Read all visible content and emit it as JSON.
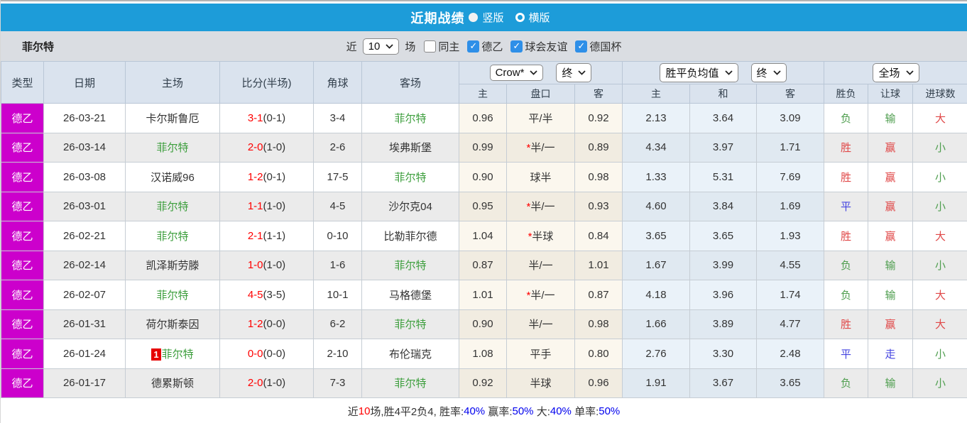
{
  "title_bar": {
    "title": "近期战绩",
    "radio_vertical": "竖版",
    "radio_horizontal": "横版"
  },
  "filter_bar": {
    "team": "菲尔特",
    "recent_label": "近",
    "recent_value": "10",
    "games_label": "场",
    "checkboxes": [
      {
        "label": "同主",
        "checked": false
      },
      {
        "label": "德乙",
        "checked": true
      },
      {
        "label": "球会友谊",
        "checked": true
      },
      {
        "label": "德国杯",
        "checked": true
      }
    ]
  },
  "table": {
    "columns": [
      "类型",
      "日期",
      "主场",
      "比分(半场)",
      "角球",
      "客场"
    ],
    "selects": {
      "bookmaker": "Crow*",
      "bookmaker_time": "终",
      "europe": "胜平负均值",
      "europe_time": "终",
      "scope": "全场"
    },
    "sub_columns": [
      "主",
      "盘口",
      "客",
      "主",
      "和",
      "客",
      "胜负",
      "让球",
      "进球数"
    ],
    "rows": [
      {
        "league": "德乙",
        "date": "26-03-21",
        "badge": "",
        "home": "卡尔斯鲁厄",
        "home_focus": false,
        "score": "3-1",
        "half": "(0-1)",
        "corners": "3-4",
        "away": "菲尔特",
        "away_focus": true,
        "ah_home": "0.96",
        "star": false,
        "handicap": "平/半",
        "ah_away": "0.92",
        "eu_home": "2.13",
        "eu_draw": "3.64",
        "eu_away": "3.09",
        "result": "负",
        "result_color": "green",
        "let_result": "输",
        "let_color": "green",
        "goal_result": "大",
        "goal_color": "red"
      },
      {
        "league": "德乙",
        "date": "26-03-14",
        "badge": "",
        "home": "菲尔特",
        "home_focus": true,
        "score": "2-0",
        "half": "(1-0)",
        "corners": "2-6",
        "away": "埃弗斯堡",
        "away_focus": false,
        "ah_home": "0.99",
        "star": true,
        "handicap": "半/一",
        "ah_away": "0.89",
        "eu_home": "4.34",
        "eu_draw": "3.97",
        "eu_away": "1.71",
        "result": "胜",
        "result_color": "red",
        "let_result": "赢",
        "let_color": "red",
        "goal_result": "小",
        "goal_color": "green"
      },
      {
        "league": "德乙",
        "date": "26-03-08",
        "badge": "",
        "home": "汉诺威96",
        "home_focus": false,
        "score": "1-2",
        "half": "(0-1)",
        "corners": "17-5",
        "away": "菲尔特",
        "away_focus": true,
        "ah_home": "0.90",
        "star": false,
        "handicap": "球半",
        "ah_away": "0.98",
        "eu_home": "1.33",
        "eu_draw": "5.31",
        "eu_away": "7.69",
        "result": "胜",
        "result_color": "red",
        "let_result": "赢",
        "let_color": "red",
        "goal_result": "小",
        "goal_color": "green"
      },
      {
        "league": "德乙",
        "date": "26-03-01",
        "badge": "",
        "home": "菲尔特",
        "home_focus": true,
        "score": "1-1",
        "half": "(1-0)",
        "corners": "4-5",
        "away": "沙尔克04",
        "away_focus": false,
        "ah_home": "0.95",
        "star": true,
        "handicap": "半/一",
        "ah_away": "0.93",
        "eu_home": "4.60",
        "eu_draw": "3.84",
        "eu_away": "1.69",
        "result": "平",
        "result_color": "blue",
        "let_result": "赢",
        "let_color": "red",
        "goal_result": "小",
        "goal_color": "green"
      },
      {
        "league": "德乙",
        "date": "26-02-21",
        "badge": "",
        "home": "菲尔特",
        "home_focus": true,
        "score": "2-1",
        "half": "(1-1)",
        "corners": "0-10",
        "away": "比勒菲尔德",
        "away_focus": false,
        "ah_home": "1.04",
        "star": true,
        "handicap": "半球",
        "ah_away": "0.84",
        "eu_home": "3.65",
        "eu_draw": "3.65",
        "eu_away": "1.93",
        "result": "胜",
        "result_color": "red",
        "let_result": "赢",
        "let_color": "red",
        "goal_result": "大",
        "goal_color": "red"
      },
      {
        "league": "德乙",
        "date": "26-02-14",
        "badge": "",
        "home": "凯泽斯劳滕",
        "home_focus": false,
        "score": "1-0",
        "half": "(1-0)",
        "corners": "1-6",
        "away": "菲尔特",
        "away_focus": true,
        "ah_home": "0.87",
        "star": false,
        "handicap": "半/一",
        "ah_away": "1.01",
        "eu_home": "1.67",
        "eu_draw": "3.99",
        "eu_away": "4.55",
        "result": "负",
        "result_color": "green",
        "let_result": "输",
        "let_color": "green",
        "goal_result": "小",
        "goal_color": "green"
      },
      {
        "league": "德乙",
        "date": "26-02-07",
        "badge": "",
        "home": "菲尔特",
        "home_focus": true,
        "score": "4-5",
        "half": "(3-5)",
        "corners": "10-1",
        "away": "马格德堡",
        "away_focus": false,
        "ah_home": "1.01",
        "star": true,
        "handicap": "半/一",
        "ah_away": "0.87",
        "eu_home": "4.18",
        "eu_draw": "3.96",
        "eu_away": "1.74",
        "result": "负",
        "result_color": "green",
        "let_result": "输",
        "let_color": "green",
        "goal_result": "大",
        "goal_color": "red"
      },
      {
        "league": "德乙",
        "date": "26-01-31",
        "badge": "",
        "home": "荷尔斯泰因",
        "home_focus": false,
        "score": "1-2",
        "half": "(0-0)",
        "corners": "6-2",
        "away": "菲尔特",
        "away_focus": true,
        "ah_home": "0.90",
        "star": false,
        "handicap": "半/一",
        "ah_away": "0.98",
        "eu_home": "1.66",
        "eu_draw": "3.89",
        "eu_away": "4.77",
        "result": "胜",
        "result_color": "red",
        "let_result": "赢",
        "let_color": "red",
        "goal_result": "大",
        "goal_color": "red"
      },
      {
        "league": "德乙",
        "date": "26-01-24",
        "badge": "1",
        "home": "菲尔特",
        "home_focus": true,
        "score": "0-0",
        "half": "(0-0)",
        "corners": "2-10",
        "away": "布伦瑞克",
        "away_focus": false,
        "ah_home": "1.08",
        "star": false,
        "handicap": "平手",
        "ah_away": "0.80",
        "eu_home": "2.76",
        "eu_draw": "3.30",
        "eu_away": "2.48",
        "result": "平",
        "result_color": "blue",
        "let_result": "走",
        "let_color": "blue",
        "goal_result": "小",
        "goal_color": "green"
      },
      {
        "league": "德乙",
        "date": "26-01-17",
        "badge": "",
        "home": "德累斯顿",
        "home_focus": false,
        "score": "2-0",
        "half": "(1-0)",
        "corners": "7-3",
        "away": "菲尔特",
        "away_focus": true,
        "ah_home": "0.92",
        "star": false,
        "handicap": "半球",
        "ah_away": "0.96",
        "eu_home": "1.91",
        "eu_draw": "3.67",
        "eu_away": "3.65",
        "result": "负",
        "result_color": "green",
        "let_result": "输",
        "let_color": "green",
        "goal_result": "小",
        "goal_color": "green"
      }
    ]
  },
  "footer": {
    "segments": [
      {
        "text": "近",
        "color": "dark"
      },
      {
        "text": "10",
        "color": "red"
      },
      {
        "text": "场,胜4平2负4, 胜率:",
        "color": "dark"
      },
      {
        "text": "40%",
        "color": "blue"
      },
      {
        "text": " 赢率:",
        "color": "dark"
      },
      {
        "text": "50%",
        "color": "blue"
      },
      {
        "text": " 大:",
        "color": "dark"
      },
      {
        "text": "40%",
        "color": "blue"
      },
      {
        "text": " 单率:",
        "color": "dark"
      },
      {
        "text": "50%",
        "color": "blue"
      }
    ]
  }
}
